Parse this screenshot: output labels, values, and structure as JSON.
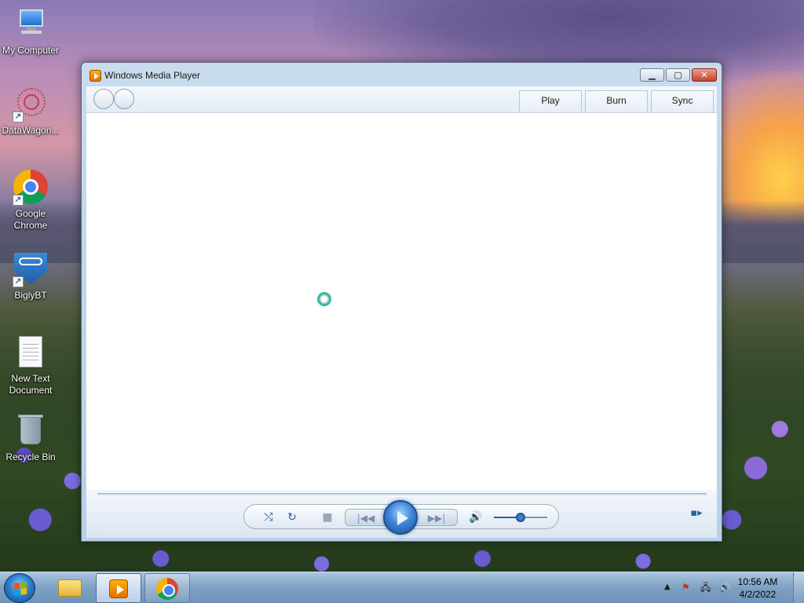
{
  "desktop": {
    "icons": [
      {
        "label": "My Computer"
      },
      {
        "label": "DataWagon..."
      },
      {
        "label": "Google Chrome"
      },
      {
        "label": "BiglyBT"
      },
      {
        "label": "New Text Document"
      },
      {
        "label": "Recycle Bin"
      }
    ]
  },
  "window": {
    "title": "Windows Media Player",
    "caption": {
      "minimize": "▁",
      "maximize": "▢",
      "close": "✕"
    },
    "tabs": [
      {
        "label": "Play"
      },
      {
        "label": "Burn"
      },
      {
        "label": "Sync"
      }
    ],
    "controls": {
      "shuffle_glyph": "⤭",
      "repeat_glyph": "↻",
      "stop_glyph": "■",
      "prev_glyph": "|◀◀",
      "next_glyph": "▶▶|",
      "mute_glyph": "🔊",
      "volume": 0.5,
      "switch_view_glyph": "▪▸"
    }
  },
  "taskbar": {
    "clock_time": "10:56 AM",
    "clock_date": "4/2/2022",
    "tray_arrow": "▲",
    "tray_flag_glyph": "⚑",
    "tray_net_glyph": "🖧",
    "tray_volume_glyph": "🔊"
  },
  "colors": {
    "accent": "#2a5fa0",
    "play_button": "#3d86d6"
  }
}
